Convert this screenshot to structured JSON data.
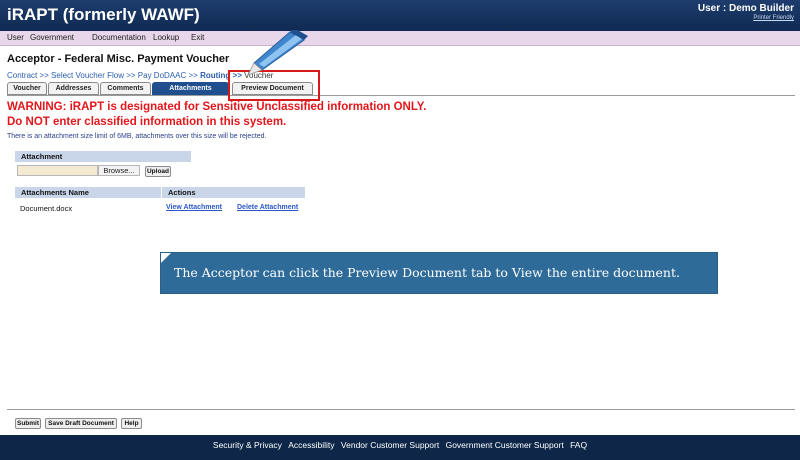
{
  "app": {
    "title": "iRAPT (formerly WAWF)"
  },
  "user": {
    "label": "User : Demo Builder",
    "printer_friendly": "Printer Friendly"
  },
  "menu": {
    "items": [
      "User",
      "Government",
      "Documentation",
      "Lookup",
      "Exit"
    ]
  },
  "page": {
    "heading": "Acceptor - Federal Misc. Payment Voucher"
  },
  "breadcrumb": {
    "items": [
      "Contract",
      ">>",
      "Select Voucher Flow",
      ">>",
      "Pay DoDAAC",
      ">>",
      "Routing",
      ">>",
      "Voucher"
    ]
  },
  "tabs": [
    "Voucher",
    "Addresses",
    "Comments",
    "Attachments",
    "Preview Document"
  ],
  "warning": {
    "line1": "WARNING: iRAPT is designated for Sensitive Unclassified information ONLY.",
    "line2": "Do NOT enter classified information in this system."
  },
  "limit_note": "There is an attachment size limit of 6MB, attachments over this size will be rejected.",
  "attachment": {
    "header": "Attachment",
    "browse_label": "Browse...",
    "upload_label": "Upload"
  },
  "attachments_table": {
    "col_name": "Attachments Name",
    "col_actions": "Actions",
    "rows": [
      {
        "name": "Document.docx",
        "view": "View Attachment",
        "delete": "Delete Attachment"
      }
    ]
  },
  "callout": {
    "text": "The Acceptor can click the Preview Document tab to View the entire document."
  },
  "bottom_buttons": {
    "submit": "Submit",
    "save_draft": "Save Draft Document",
    "help": "Help"
  },
  "footer": {
    "links": [
      "Security & Privacy",
      "Accessibility",
      "Vendor Customer Support",
      "Government Customer Support",
      "FAQ"
    ]
  },
  "colors": {
    "header_bg": "#0f2a52",
    "menu_bg": "#e8d6ea",
    "warning": "#e3161b",
    "link": "#2b57c7",
    "active_tab": "#1f4f8f",
    "callout_bg": "#2e6b98",
    "highlight": "#d61a1a"
  }
}
